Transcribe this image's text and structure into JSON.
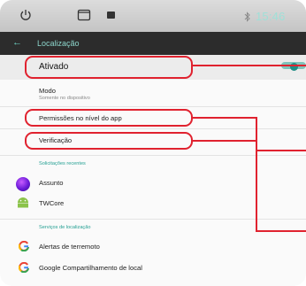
{
  "status_bar": {
    "clock": "15:46",
    "icons": [
      "power-icon",
      "recents-icon",
      "media-icon",
      "bluetooth-icon"
    ]
  },
  "app_bar": {
    "back_icon": "arrow-back-icon",
    "title": "Localização"
  },
  "location_toggle": {
    "label": "Ativado",
    "state": "on"
  },
  "mode": {
    "title": "Modo",
    "summary": "Somente no dispositivo"
  },
  "app_permissions": {
    "title": "Permissões no nível do app"
  },
  "verification": {
    "title": "Verificação"
  },
  "recent_requests": {
    "header": "Solicitações recentes",
    "items": [
      {
        "label": "Assunto",
        "icon": "assunto-app-icon"
      },
      {
        "label": "TWCore",
        "icon": "android-icon"
      }
    ]
  },
  "location_services": {
    "header": "Serviços de localização",
    "items": [
      {
        "label": "Alertas de terremoto",
        "icon": "google-icon"
      },
      {
        "label": "Google Compartilhamento de local",
        "icon": "google-icon"
      }
    ]
  },
  "colors": {
    "accent": "#24a093",
    "callout": "#e0222f",
    "app_bar": "#2c2c2c"
  }
}
